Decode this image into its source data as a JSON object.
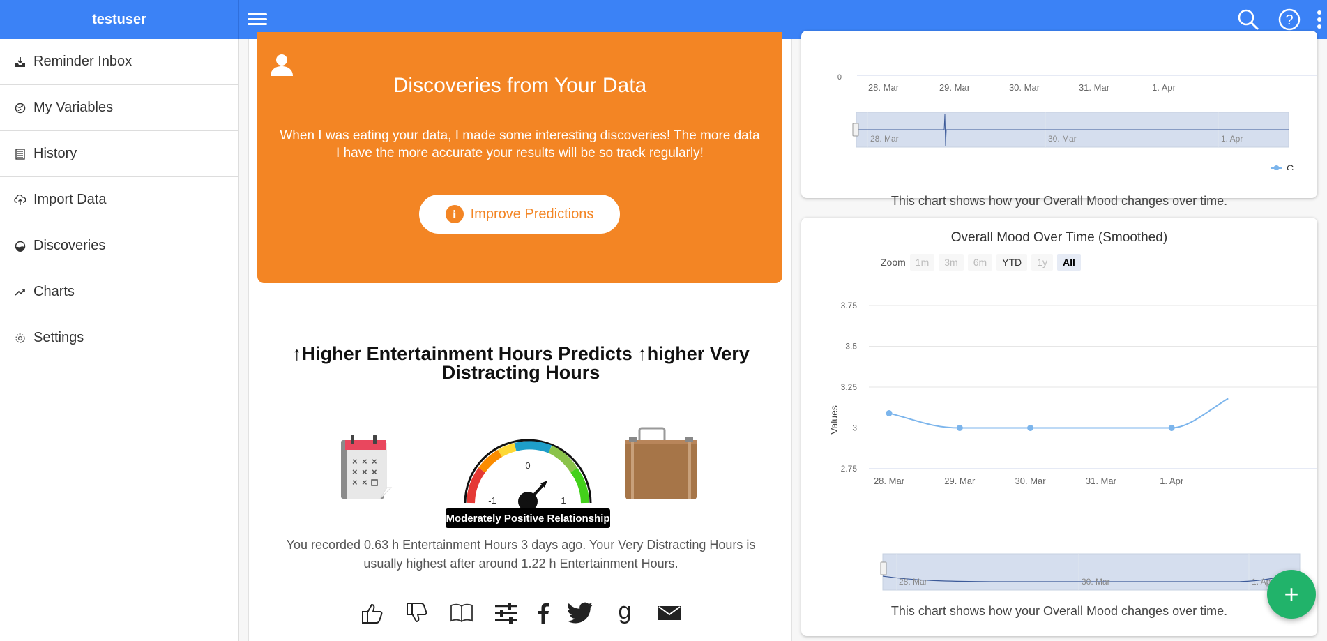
{
  "header": {
    "username": "testuser"
  },
  "sidebar": {
    "items": [
      {
        "label": "Reminder Inbox",
        "icon": "inbox-download-icon"
      },
      {
        "label": "My Variables",
        "icon": "globe-icon"
      },
      {
        "label": "History",
        "icon": "list-icon"
      },
      {
        "label": "Import Data",
        "icon": "cloud-upload-icon"
      },
      {
        "label": "Discoveries",
        "icon": "discovery-icon"
      },
      {
        "label": "Charts",
        "icon": "trending-icon"
      },
      {
        "label": "Settings",
        "icon": "gear-icon"
      }
    ]
  },
  "discoveries": {
    "title": "Discoveries from Your Data",
    "text": "When I was eating your data, I made some interesting discoveries! The more data I have the more accurate your results will be so track regularly!",
    "button_label": "Improve Predictions",
    "button_icon_glyph": "i"
  },
  "study": {
    "title_line1": "↑Higher Entertainment Hours Predicts ↑higher Very",
    "title_line2": "Distracting Hours",
    "gauge_label": "Moderately Positive Relationship",
    "gauge_ticks": [
      "-1",
      "0",
      "1"
    ],
    "text": "You recorded 0.63 h Entertainment Hours 3 days ago. Your Very Distracting Hours is usually highest after around 1.22 h Entertainment Hours."
  },
  "chart_top": {
    "x_ticks": [
      "28. Mar",
      "29. Mar",
      "30. Mar",
      "31. Mar",
      "1. Apr"
    ],
    "y_tick_visible": "0",
    "navigator_ticks": [
      "28. Mar",
      "30. Mar",
      "1. Apr"
    ],
    "legend_text": "C",
    "caption": "This chart shows how your Overall Mood changes over time."
  },
  "chart_data": {
    "type": "line",
    "title": "Overall Mood Over Time (Smoothed)",
    "ylabel": "Values",
    "xlabel": "",
    "x": [
      "28. Mar",
      "29. Mar",
      "30. Mar",
      "31. Mar",
      "1. Apr"
    ],
    "y_ticks": [
      "3.75",
      "3.5",
      "3.25",
      "3",
      "2.75"
    ],
    "ylim": [
      2.75,
      3.75
    ],
    "points": [
      {
        "x": 0.0,
        "y": 3.09
      },
      {
        "x": 1.0,
        "y": 3.0
      },
      {
        "x": 2.0,
        "y": 3.0
      },
      {
        "x": 4.0,
        "y": 3.0
      }
    ],
    "curve_end": {
      "x": 4.8,
      "y": 3.18
    },
    "zoom_label": "Zoom",
    "zoom_buttons": [
      {
        "label": "1m",
        "state": "disabled"
      },
      {
        "label": "3m",
        "state": "disabled"
      },
      {
        "label": "6m",
        "state": "disabled"
      },
      {
        "label": "YTD",
        "state": "enabled"
      },
      {
        "label": "1y",
        "state": "disabled"
      },
      {
        "label": "All",
        "state": "active"
      }
    ],
    "navigator_ticks": [
      "28. Mar",
      "30. Mar",
      "1. Apr"
    ],
    "caption": "This chart shows how your Overall Mood changes over time.",
    "series_color": "#7cb5ec",
    "grid": true
  },
  "colors": {
    "topbar": "#3b82f6",
    "orange": "#f38524",
    "fab": "#21b36a"
  },
  "fab": {
    "label": "+"
  }
}
